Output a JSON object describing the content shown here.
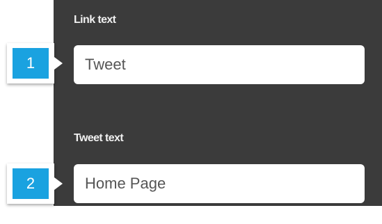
{
  "form": {
    "link_text": {
      "label": "Link text",
      "value": "Tweet"
    },
    "tweet_text": {
      "label": "Tweet text",
      "value": "Home Page"
    }
  },
  "callouts": {
    "first": "1",
    "second": "2"
  },
  "colors": {
    "panel_bg": "#3b3b3b",
    "callout_accent": "#1aa2e0",
    "label_text": "#f0f0f0"
  }
}
